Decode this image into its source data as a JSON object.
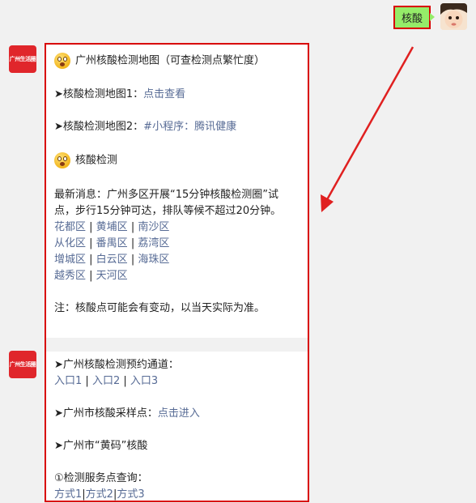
{
  "user": {
    "message": "核酸"
  },
  "official_account": {
    "avatar_label": "广州生活圈"
  },
  "message1": {
    "heading": "广州核酸检测地图（可查检测点繁忙度）",
    "map1_prefix": "➤核酸检测地图1：",
    "map1_link": "点击查看",
    "map2_prefix": "➤核酸检测地图2：",
    "map2_link": "#小程序：腾讯健康",
    "section2": "核酸检测",
    "news_line1": "最新消息：广州多区开展“15分钟核酸检测圈”试",
    "news_line2": "点，步行15分钟可达，排队等候不超过20分钟。",
    "district_rows": [
      [
        "花都区",
        "黄埔区",
        "南沙区"
      ],
      [
        "从化区",
        "番禺区",
        "荔湾区"
      ],
      [
        "增城区",
        "白云区",
        "海珠区"
      ],
      [
        "越秀区",
        "天河区"
      ]
    ],
    "note": "注：核酸点可能会有变动，以当天实际为准。"
  },
  "message2": {
    "booking_title": "➤广州核酸检测预约通道：",
    "entries": [
      "入口1",
      "入口2",
      "入口3"
    ],
    "sampling_prefix": "➤广州市核酸采样点：",
    "sampling_link": "点击进入",
    "yellow_code": "➤广州市“黄码”核酸",
    "service_query": "①检测服务点查询：",
    "methods": [
      "方式1",
      "方式2",
      "方式3"
    ]
  },
  "colors": {
    "link": "#576b95",
    "highlight": "#d80000",
    "user_bubble": "#95ec69"
  }
}
